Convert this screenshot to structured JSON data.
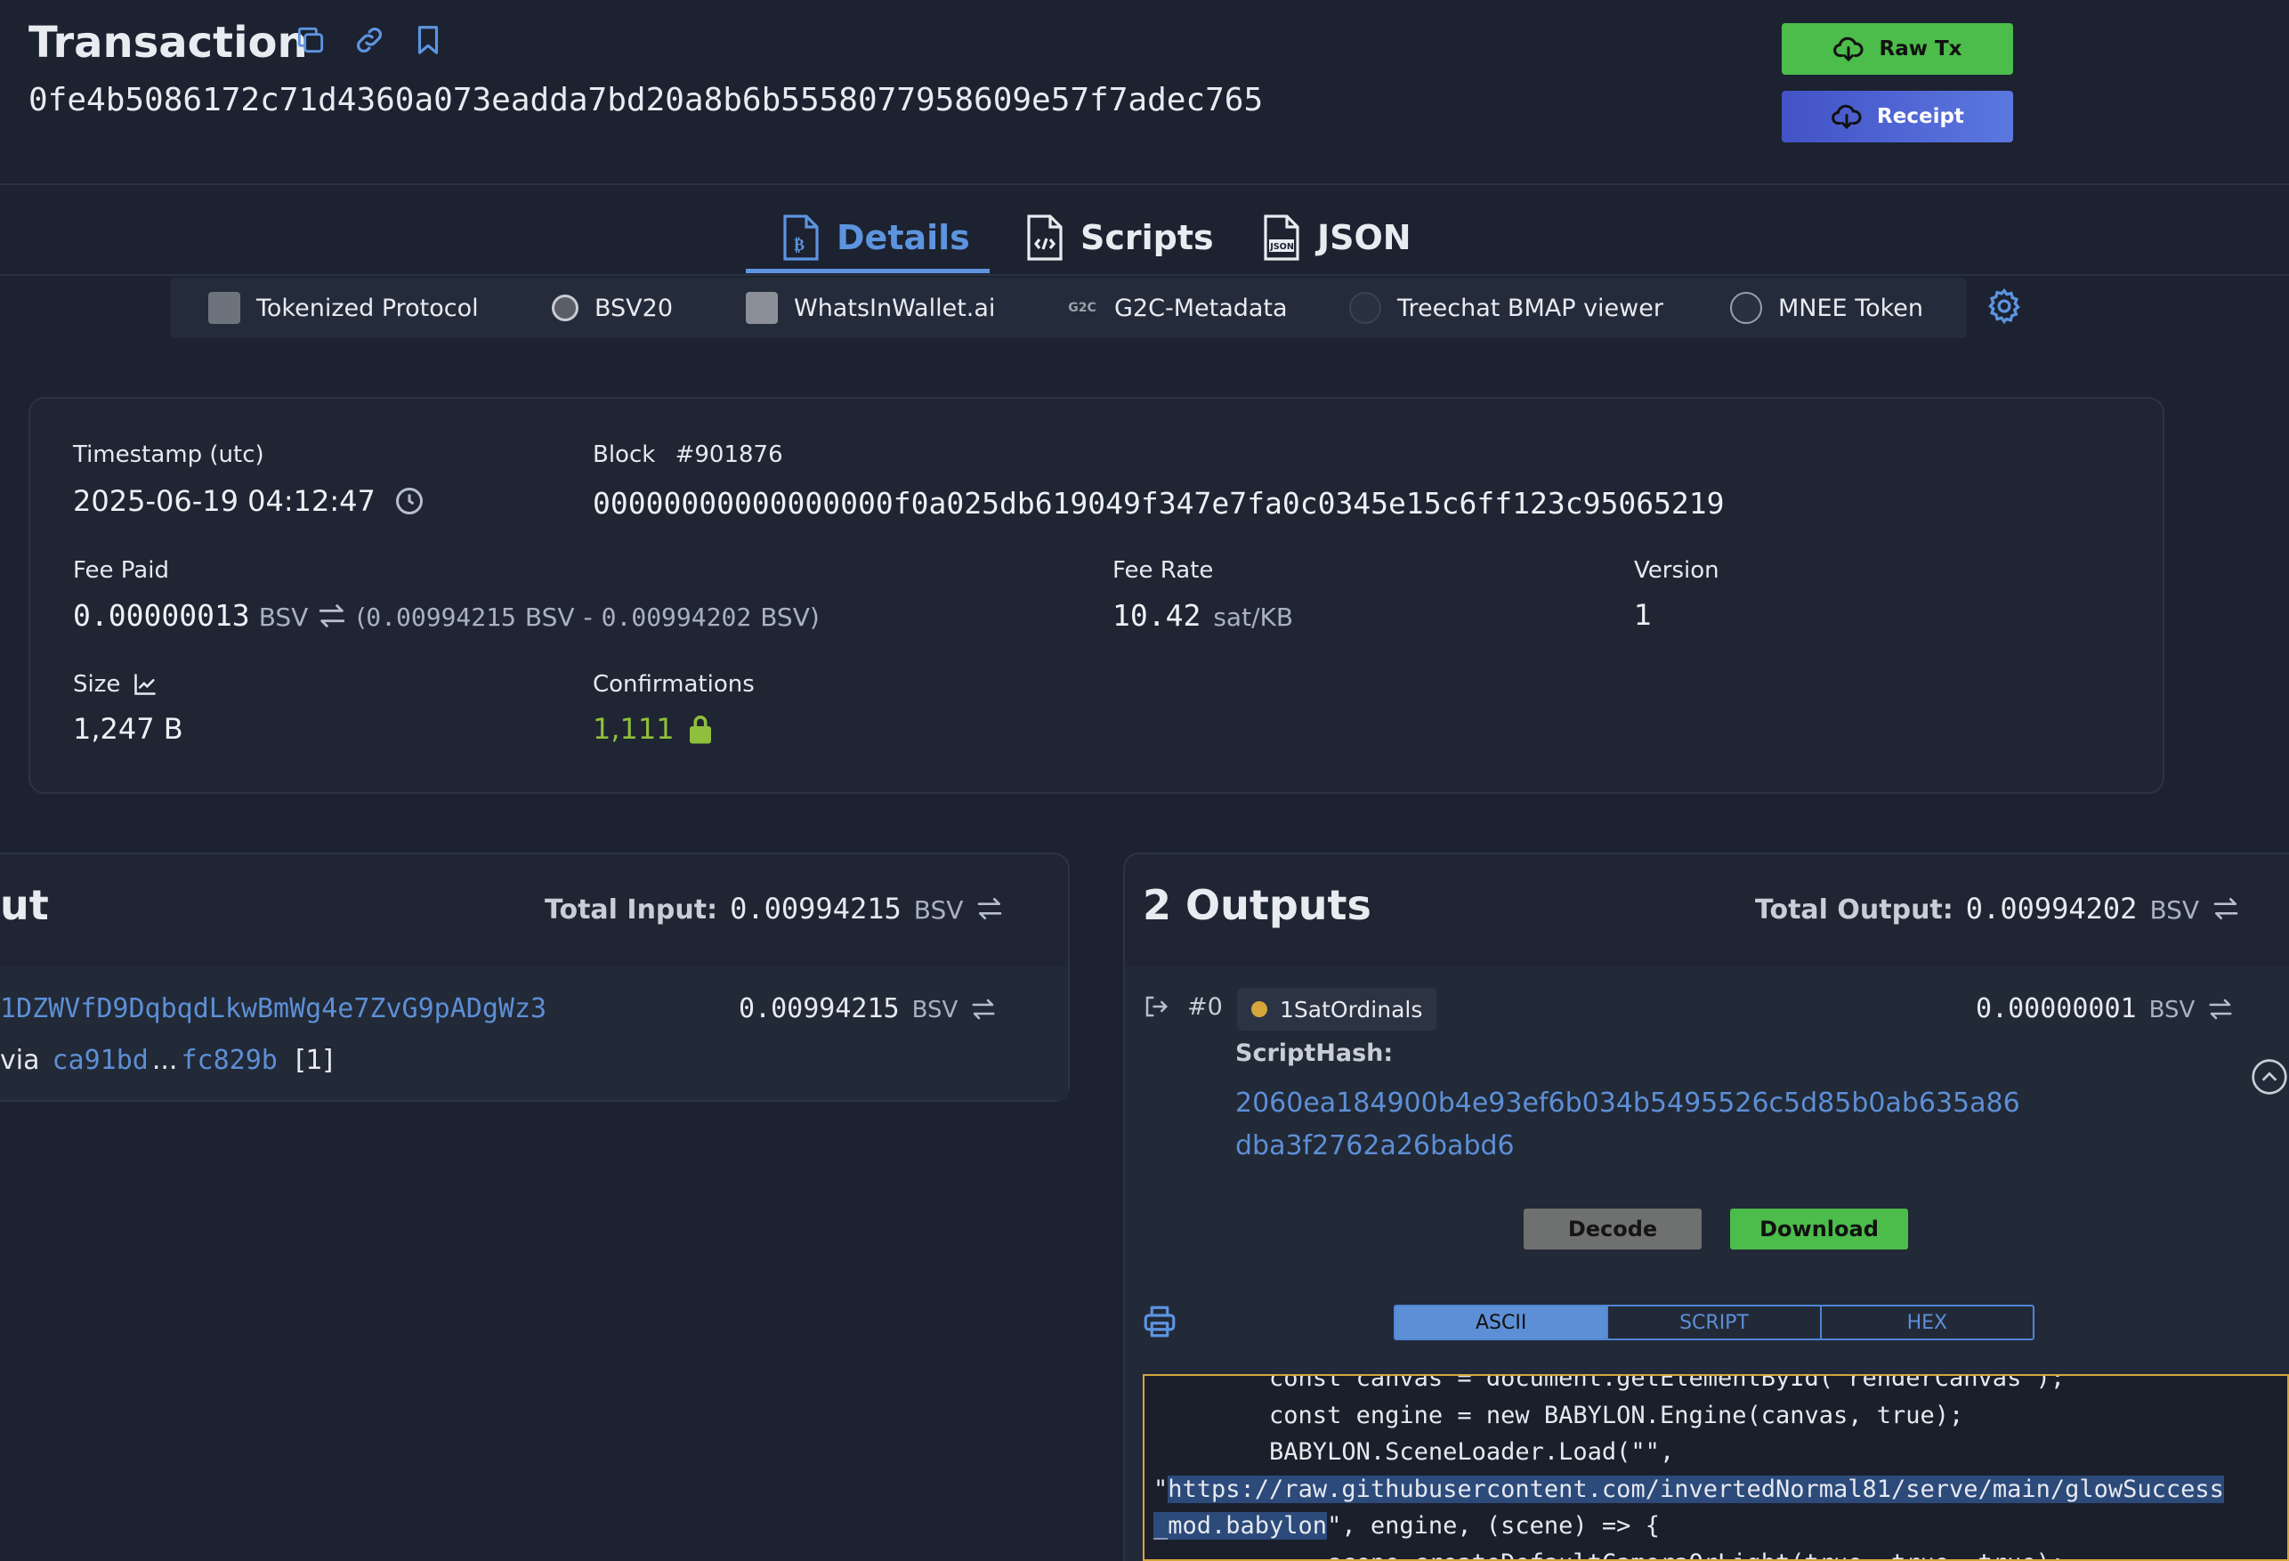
{
  "header": {
    "title": "Transaction",
    "txid": "0fe4b5086172c71d4360a073eadda7bd20a8b6b5558077958609e57f7adec765",
    "raw_tx_label": "Raw Tx",
    "receipt_label": "Receipt"
  },
  "tabs": [
    {
      "label": "Details",
      "active": true,
      "icon": "bitcoin-doc-icon"
    },
    {
      "label": "Scripts",
      "active": false,
      "icon": "code-doc-icon"
    },
    {
      "label": "JSON",
      "active": false,
      "icon": "json-doc-icon"
    }
  ],
  "plugins": [
    {
      "label": "Tokenized Protocol",
      "icon": "tokenized-icon"
    },
    {
      "label": "BSV20",
      "icon": "bsv20-icon"
    },
    {
      "label": "WhatsInWallet.ai",
      "icon": "whatsinwallet-icon"
    },
    {
      "label": "G2C-Metadata",
      "icon": "g2c-icon"
    },
    {
      "label": "Treechat BMAP viewer",
      "icon": "treechat-icon"
    },
    {
      "label": "MNEE Token",
      "icon": "mnee-icon"
    }
  ],
  "details": {
    "timestamp_label": "Timestamp (utc)",
    "timestamp_value": "2025-06-19 04:12:47",
    "block_label": "Block",
    "block_number": "#901876",
    "block_hash": "00000000000000000f0a025db619049f347e7fa0c0345e15c6ff123c95065219",
    "fee_paid_label": "Fee Paid",
    "fee_paid_value": "0.00000013",
    "fee_paid_unit": "BSV",
    "fee_calc_open": "(",
    "fee_calc_in": "0.00994215",
    "fee_calc_in_unit": "BSV",
    "fee_calc_minus": "-",
    "fee_calc_out": "0.00994202",
    "fee_calc_out_unit": "BSV)",
    "fee_rate_label": "Fee Rate",
    "fee_rate_value": "10.42",
    "fee_rate_unit": "sat/KB",
    "version_label": "Version",
    "version_value": "1",
    "size_label": "Size",
    "size_value": "1,247 B",
    "confirmations_label": "Confirmations",
    "confirmations_value": "1,111"
  },
  "inputs": {
    "title": "ut",
    "total_label": "Total Input:",
    "total_value": "0.00994215",
    "total_unit": "BSV",
    "item": {
      "address": "1DZWVfD9DqbqdLkwBmWg4e7ZvG9pADgWz3",
      "amount": "0.00994215",
      "unit": "BSV",
      "via_label": "via",
      "via_start": "ca91bd",
      "via_ellipsis": "...",
      "via_end": "fc829b",
      "via_index": "[1]"
    }
  },
  "outputs": {
    "title": "2 Outputs",
    "total_label": "Total Output:",
    "total_value": "0.00994202",
    "total_unit": "BSV",
    "item": {
      "index": "#0",
      "badge": "1SatOrdinals",
      "amount": "0.00000001",
      "unit": "BSV",
      "scripthash_label": "ScriptHash:",
      "scripthash_line1": "2060ea184900b4e93ef6b034b5495526c5d85b0ab635a86",
      "scripthash_line2": "dba3f2762a26babd6",
      "decode_label": "Decode",
      "download_label": "Download",
      "view_modes": [
        "ASCII",
        "SCRIPT",
        "HEX"
      ],
      "active_view": "ASCII",
      "code_line0": "        const canvas = document.getElementById(\"renderCanvas\");",
      "code_line1": "        const engine = new BABYLON.Engine(canvas, true);",
      "code_line2": "        BABYLON.SceneLoader.Load(\"\",",
      "code_line3_pre": "\"",
      "code_line3_hl": "https://raw.githubusercontent.com/invertedNormal81/serve/main/glowSuccess",
      "code_line4_hl": "_mod.babylon",
      "code_line4_post": "\", engine, (scene) => {",
      "code_line5": "            scene.createDefaultCameraOrLight(true, true, true);"
    }
  },
  "colors": {
    "background": "#1c2230",
    "accent": "#5d94e0",
    "green": "#4cbc4a",
    "confirm_green": "#8fbf3c",
    "ordinal_dot": "#d6a63a"
  }
}
